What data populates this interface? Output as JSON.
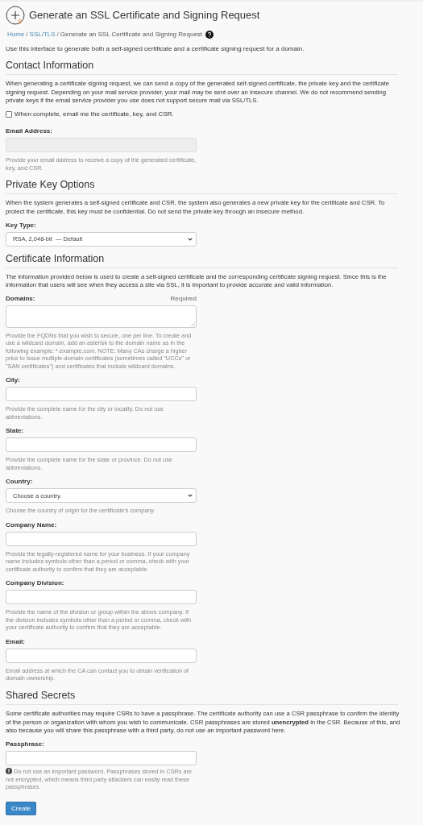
{
  "page_title": "Generate an SSL Certificate and Signing Request",
  "breadcrumb": [
    {
      "label": "Home",
      "link": true
    },
    {
      "label": "SSL/TLS",
      "link": true
    },
    {
      "label": "Generate an SSL Certificate and Signing Request",
      "link": false
    }
  ],
  "breadcrumb_separator": "/",
  "intro": "Use this interface to generate both a self-signed certificate and a certificate signing request for a domain.",
  "sections": [
    {
      "heading": "Contact Information",
      "description": "When generating a certificate signing request, we can send a copy of the generated self-signed certificate, the private key and the certificate signing request. Depending on your mail service provider, your mail may be sent over an insecure channel. We do not recommend sending private keys if the email service provider you use does not support secure mail via SSL/TLS.",
      "fields": [
        {
          "kind": "checkbox",
          "label": "When complete, email me the certificate, key, and CSR.",
          "checked": false
        },
        {
          "kind": "text",
          "label": "Email Address:",
          "disabled": true,
          "help": "Provide your email address to receive a copy of the generated certificate, key, and CSR."
        }
      ]
    },
    {
      "heading": "Private Key Options",
      "description": "When the system generates a self-signed certificate and CSR, the system also generates a new private key for the certificate and CSR. To protect the certificate, this key must be confidential. Do not send the private key through an insecure method.",
      "fields": [
        {
          "kind": "select",
          "label": "Key Type:",
          "value": "RSA, 2,048-bit  — Default"
        }
      ]
    },
    {
      "heading": "Certificate Information",
      "description": "The information provided below is used to create a self-signed certificate and the corresponding certificate signing request. Since this is the information that users will see when they access a site via SSL, it is important to provide accurate and valid information.",
      "fields": [
        {
          "kind": "textarea",
          "label": "Domains:",
          "required_note": "Required",
          "help": "Provide the FQDNs that you wish to secure, one per line. To create and use a wildcard domain, add an asterisk to the domain name as in the following example: *.example.com. NOTE: Many CAs charge a higher price to issue multiple-domain certificates (sometimes called \"UCCs\" or \"SAN certificates\") and certificates that include wildcard domains."
        },
        {
          "kind": "text",
          "label": "City:",
          "disabled": false,
          "help": "Provide the complete name for the city or locality. Do not use abbreviations."
        },
        {
          "kind": "text",
          "label": "State:",
          "disabled": false,
          "help": "Provide the complete name for the state or province. Do not use abbreviations."
        },
        {
          "kind": "select",
          "label": "Country:",
          "value": "Choose a country.",
          "help": "Choose the country of origin for the certificate’s company."
        },
        {
          "kind": "text",
          "label": "Company Name:",
          "disabled": false,
          "help": "Provide the legally-registered name for your business. If your company name includes symbols other than a period or comma, check with your certificate authority to confirm that they are acceptable."
        },
        {
          "kind": "text",
          "label": "Company Division:",
          "disabled": false,
          "help": "Provide the name of the division or group within the above company. If the division includes symbols other than a period or comma, check with your certificate authority to confirm that they are acceptable."
        },
        {
          "kind": "text",
          "label": "Email:",
          "disabled": false,
          "help": "Email address at which the CA can contact you to obtain verification of domain ownership."
        }
      ]
    },
    {
      "heading": "Shared Secrets",
      "description": "Some certificate authorities may require CSRs to have a passphrase. The certificate authority can use a CSR passphrase to confirm the identity of the person or organization with whom you wish to communicate. CSR passphrases are stored **unencrypted** in the CSR. Because of this, and also because you will share this passphrase with a third party, do not use an important password here.",
      "fields": [
        {
          "kind": "passphrase",
          "label": "Passphrase:",
          "help": "Do not use an important password. Passphrases stored in CSRs are not encrypted, which means third party attackers can easily read these passphrases."
        }
      ]
    }
  ],
  "submit_button": "Create"
}
